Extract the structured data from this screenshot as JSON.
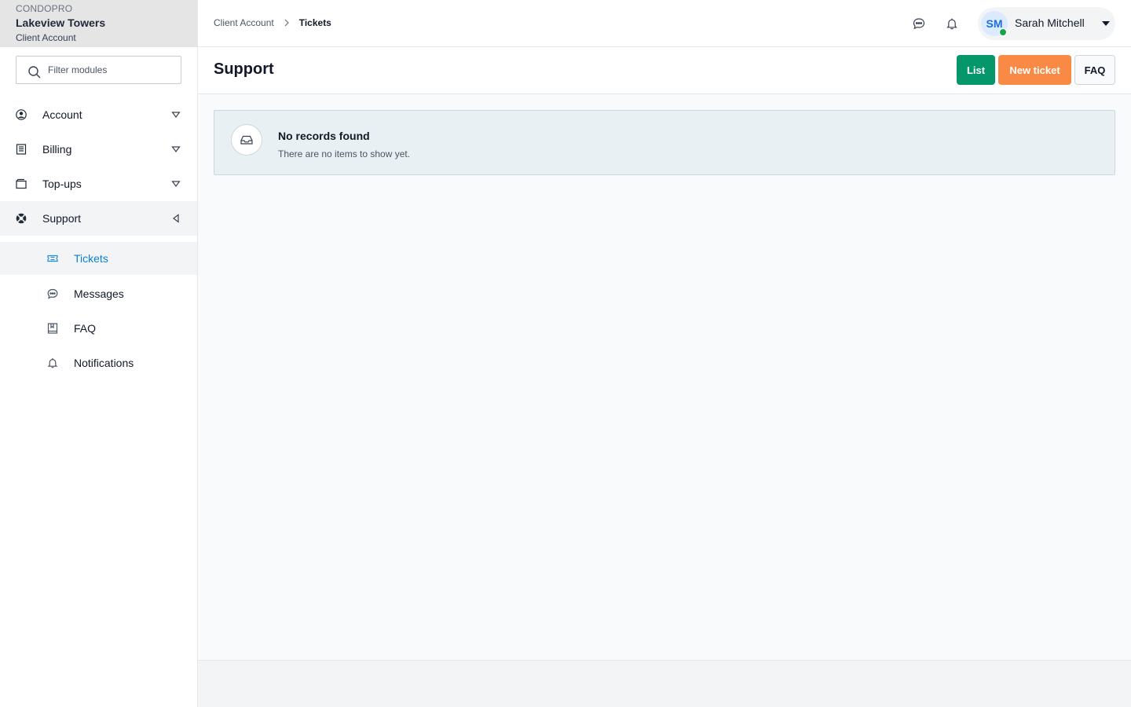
{
  "brand": {
    "org": "CONDOPRO",
    "name": "Lakeview Towers",
    "account_type": "Client Account"
  },
  "sidebar": {
    "filter_placeholder": "Filter modules",
    "items": [
      {
        "label": "Account",
        "icon": "user-circle-icon",
        "state": "collapsed"
      },
      {
        "label": "Billing",
        "icon": "invoice-icon",
        "state": "collapsed"
      },
      {
        "label": "Top-ups",
        "icon": "wallet-icon",
        "state": "collapsed"
      },
      {
        "label": "Support",
        "icon": "lifebuoy-icon",
        "state": "expanded"
      }
    ],
    "support_children": [
      {
        "label": "Tickets",
        "icon": "ticket-icon",
        "active": true
      },
      {
        "label": "Messages",
        "icon": "chat-bubble-icon",
        "active": false
      },
      {
        "label": "FAQ",
        "icon": "book-icon",
        "active": false
      },
      {
        "label": "Notifications",
        "icon": "bell-icon",
        "active": false
      }
    ]
  },
  "breadcrumb": {
    "parent": "Client Account",
    "current": "Tickets"
  },
  "user": {
    "initials": "SM",
    "name": "Sarah Mitchell",
    "status": "online"
  },
  "page": {
    "title": "Support",
    "buttons": {
      "list": "List",
      "new_ticket": "New ticket",
      "faq": "FAQ"
    }
  },
  "empty_state": {
    "title": "No records found",
    "message": "There are no items to show yet."
  },
  "colors": {
    "primary_green": "#059669",
    "accent_orange": "#f88a45",
    "active_blue": "#0a7fd3",
    "online_green": "#16a34a",
    "empty_bg": "#e9f0f3"
  }
}
